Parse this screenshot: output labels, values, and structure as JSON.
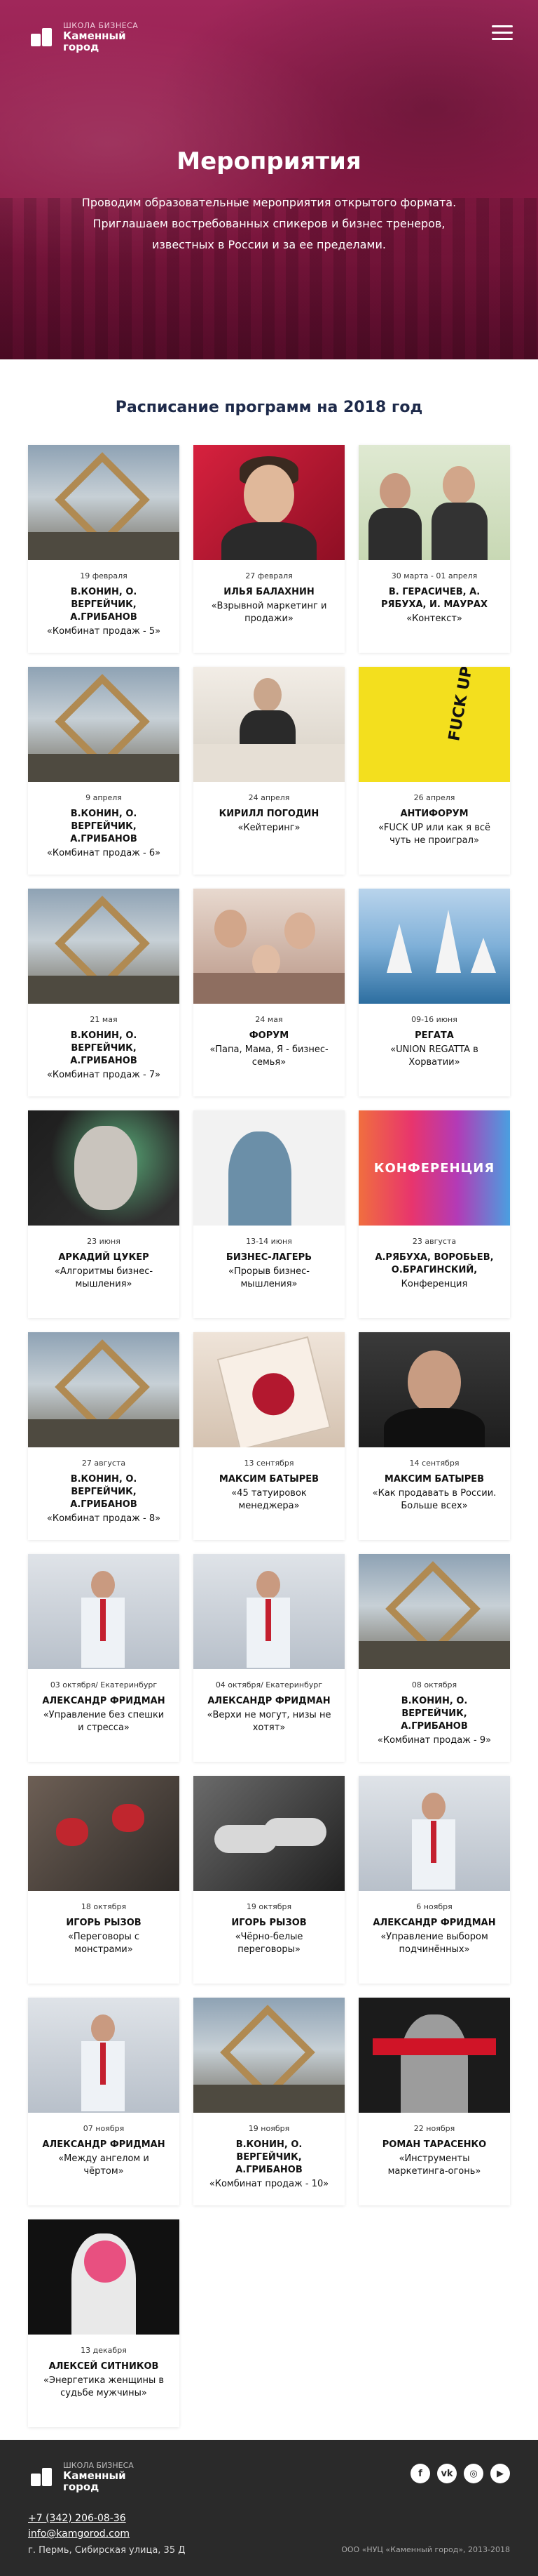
{
  "brand": {
    "line1": "ШКОЛА БИЗНЕСА",
    "line2a": "Каменный",
    "line2b": "город"
  },
  "hero": {
    "title": "Мероприятия",
    "sub1": "Проводим образовательные мероприятия открытого формата.",
    "sub2": "Приглашаем востребованных спикеров и бизнес тренеров,",
    "sub3": "известных в России и за ее пределами."
  },
  "schedule": {
    "title": "Расписание программ на 2018 год"
  },
  "events": [
    {
      "date": "19 февраля",
      "title": "В.КОНИН, О. ВЕРГЕЙЧИК, А.ГРИБАНОВ",
      "desc": "«Комбинат продаж - 5»",
      "art": "ladder"
    },
    {
      "date": "27 февраля",
      "title": "ИЛЬЯ БАЛАХНИН",
      "desc": "«Взрывной маркетинг и продажи»",
      "art": "red"
    },
    {
      "date": "30 марта - 01 апреля",
      "title": "В. ГЕРАСИЧЕВ, А. РЯБУХА, И. МАУРАХ",
      "desc": "«Контекст»",
      "art": "green"
    },
    {
      "date": "9 апреля",
      "title": "В.КОНИН, О. ВЕРГЕЙЧИК, А.ГРИБАНОВ",
      "desc": "«Комбинат продаж - 6»",
      "art": "ladder"
    },
    {
      "date": "24 апреля",
      "title": "КИРИЛЛ ПОГОДИН",
      "desc": "«Кейтеринг»",
      "art": "light"
    },
    {
      "date": "26 апреля",
      "title": "АНТИФОРУМ",
      "desc": "«FUCK UP или как я всё чуть не проиграл»",
      "art": "yellow"
    },
    {
      "date": "21 мая",
      "title": "В.КОНИН, О. ВЕРГЕЙЧИК, А.ГРИБАНОВ",
      "desc": "«Комбинат продаж - 7»",
      "art": "ladder"
    },
    {
      "date": "24 мая",
      "title": "ФОРУМ",
      "desc": "«Папа, Мама, Я - бизнес-семья»",
      "art": "family"
    },
    {
      "date": "09-16 июня",
      "title": "РЕГАТА",
      "desc": "«UNION REGATTA в Хорватии»",
      "art": "sea"
    },
    {
      "date": "23 июня",
      "title": "АРКАДИЙ ЦУКЕР",
      "desc": "«Алгоритмы бизнес-мышления»",
      "art": "statue"
    },
    {
      "date": "13-14 июня",
      "title": "БИЗНЕС-ЛАГЕРЬ",
      "desc": "«Прорыв бизнес-мышления»",
      "art": "brain"
    },
    {
      "date": "23 августа",
      "title": "А.РЯБУХА, ВОРОБЬЕВ, О.БРАГИНСКИЙ,",
      "desc": "Конференция",
      "art": "grad",
      "artText": "КОНФЕРЕНЦИЯ",
      "descPlain": true
    },
    {
      "date": "27 августа",
      "title": "В.КОНИН, О. ВЕРГЕЙЧИК, А.ГРИБАНОВ",
      "desc": "«Комбинат продаж - 8»",
      "art": "ladder"
    },
    {
      "date": "13 сентября",
      "title": "МАКСИМ БАТЫРЕВ",
      "desc": "«45 татуировок менеджера»",
      "art": "book"
    },
    {
      "date": "14 сентября",
      "title": "МАКСИМ БАТЫРЕВ",
      "desc": "«Как продавать в России. Больше всех»",
      "art": "dark"
    },
    {
      "date": "03 октября/ Екатеринбург",
      "title": "АЛЕКСАНДР ФРИДМАН",
      "desc": "«Управление без спешки и стресса»",
      "art": "speaker"
    },
    {
      "date": "04 октября/ Екатеринбург",
      "title": "АЛЕКСАНДР ФРИДМАН",
      "desc": "«Верхи не могут, низы не хотят»",
      "art": "speaker"
    },
    {
      "date": "08 октября",
      "title": "В.КОНИН, О. ВЕРГЕЙЧИК, А.ГРИБАНОВ",
      "desc": "«Комбинат продаж - 9»",
      "art": "ladder"
    },
    {
      "date": "18 октября",
      "title": "ИГОРЬ РЫЗОВ",
      "desc": "«Переговоры с монстрами»",
      "art": "boxing"
    },
    {
      "date": "19 октября",
      "title": "ИГОРЬ РЫЗОВ",
      "desc": "«Чёрно-белые переговоры»",
      "art": "bw"
    },
    {
      "date": "6 ноября",
      "title": "АЛЕКСАНДР ФРИДМАН",
      "desc": "«Управление выбором подчинённых»",
      "art": "speaker"
    },
    {
      "date": "07 ноября",
      "title": "АЛЕКСАНДР ФРИДМАН",
      "desc": "«Между ангелом и чёртом»",
      "art": "speaker"
    },
    {
      "date": "19 ноября",
      "title": "В.КОНИН, О. ВЕРГЕЙЧИК, А.ГРИБАНОВ",
      "desc": "«Комбинат продаж - 10»",
      "art": "ladder"
    },
    {
      "date": "22 ноября",
      "title": "РОМАН ТАРАСЕНКО",
      "desc": "«Инструменты маркетинга-огонь»",
      "art": "redstripe"
    },
    {
      "date": "13 декабря",
      "title": "АЛЕКСЕЙ СИТНИКОВ",
      "desc": "«Энергетика женщины в судьбе мужчины»",
      "art": "pinkstatue"
    }
  ],
  "footer": {
    "phone": "+7 (342) 206-08-36",
    "email": "info@kamgorod.com",
    "address": "г. Пермь, Сибирская улица, 35 Д",
    "copyright": "ООО «НУЦ «Каменный город», 2013-2018",
    "social": [
      "f",
      "vk",
      "ig",
      "yt"
    ]
  },
  "colors": {
    "hero": "#9a1f4e",
    "footer": "#2a2a2a",
    "accent": "#e8356d"
  }
}
